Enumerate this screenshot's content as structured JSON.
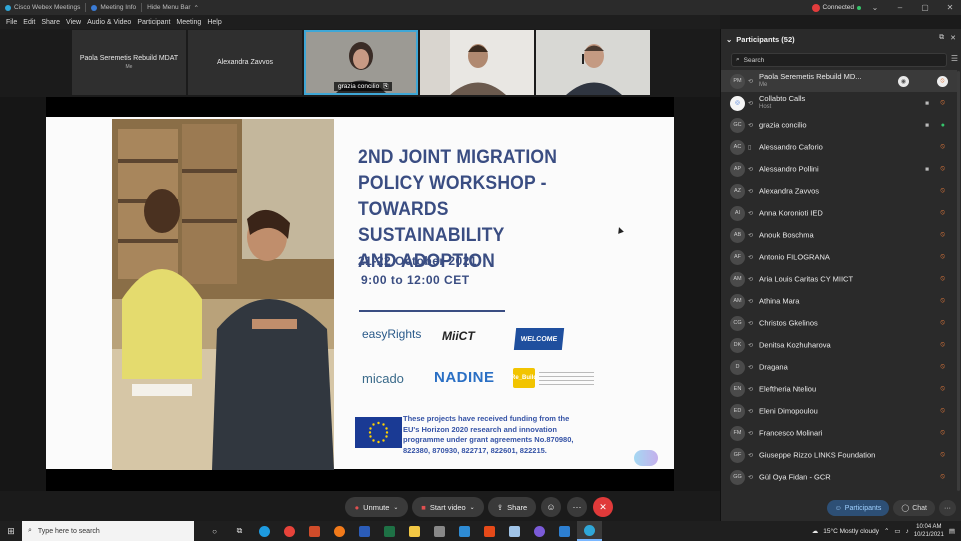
{
  "titlebar": {
    "app_title": "Cisco Webex Meetings",
    "meeting_info": "Meeting Info",
    "hide_menu_bar": "Hide Menu Bar",
    "status": "Connected"
  },
  "menu": [
    "File",
    "Edit",
    "Share",
    "View",
    "Audio & Video",
    "Participant",
    "Meeting",
    "Help"
  ],
  "video_strip": {
    "tiles": [
      {
        "name": "Paola Seremetis Rebuild MDAT",
        "sub": "Me"
      },
      {
        "name": "Alexandra Zavvos"
      },
      {
        "name": "grazia concilio"
      },
      {
        "name": ""
      },
      {
        "name": ""
      }
    ]
  },
  "slide": {
    "title_lines": [
      "2ND JOINT MIGRATION",
      "POLICY WORKSHOP -",
      "TOWARDS SUSTAINABILITY",
      "AND ADOPTION"
    ],
    "date": "21-22 October 2021",
    "time": "9:00 to 12:00 CET",
    "logos": [
      "easyRights",
      "MiiCT",
      "WELCOME",
      "micado",
      "NADINE",
      "Re_Build"
    ],
    "funding_lines": [
      "These projects have received funding from the",
      "EU's Horizon 2020 research and innovation",
      "programme under grant agreements No.870980,",
      "822380, 870930, 822717, 822601, 822215."
    ],
    "accent_color": "#3a4d82"
  },
  "controls": {
    "unmute": "Unmute",
    "start_video": "Start video",
    "share": "Share",
    "more": "···"
  },
  "panel": {
    "title": "Participants (52)",
    "search_placeholder": "Search",
    "participants": [
      {
        "initials": "PM",
        "name": "Paola Seremetis Rebuild MD...",
        "sub": "Me",
        "cam": "",
        "mic": "muted"
      },
      {
        "initials": "",
        "name": "Collabto Calls",
        "sub": "Host",
        "cam": "cam",
        "mic": "muted"
      },
      {
        "initials": "GC",
        "name": "grazia concilio",
        "sub": "",
        "cam": "cam",
        "mic": "on"
      },
      {
        "initials": "AC",
        "name": "Alessandro Caforio",
        "sub": "",
        "cam": "",
        "mic": "muted"
      },
      {
        "initials": "AP",
        "name": "Alessandro Pollini",
        "sub": "",
        "cam": "cam",
        "mic": "muted"
      },
      {
        "initials": "AZ",
        "name": "Alexandra Zavvos",
        "sub": "",
        "cam": "",
        "mic": "muted"
      },
      {
        "initials": "AI",
        "name": "Anna Koronioti IED",
        "sub": "",
        "cam": "",
        "mic": "muted"
      },
      {
        "initials": "AB",
        "name": "Anouk Boschma",
        "sub": "",
        "cam": "",
        "mic": "muted"
      },
      {
        "initials": "AF",
        "name": "Antonio FILOGRANA",
        "sub": "",
        "cam": "",
        "mic": "muted"
      },
      {
        "initials": "AM",
        "name": "Aria Louis Caritas CY MIICT",
        "sub": "",
        "cam": "",
        "mic": "muted"
      },
      {
        "initials": "AM",
        "name": "Athina Mara",
        "sub": "",
        "cam": "",
        "mic": "muted"
      },
      {
        "initials": "CG",
        "name": "Christos Gkelinos",
        "sub": "",
        "cam": "",
        "mic": "muted"
      },
      {
        "initials": "DK",
        "name": "Denitsa Kozhuharova",
        "sub": "",
        "cam": "",
        "mic": "muted"
      },
      {
        "initials": "D",
        "name": "Dragana",
        "sub": "",
        "cam": "",
        "mic": "muted"
      },
      {
        "initials": "EN",
        "name": "Eleftheria Nteliou",
        "sub": "",
        "cam": "",
        "mic": "muted"
      },
      {
        "initials": "ED",
        "name": "Eleni Dimopoulou",
        "sub": "",
        "cam": "",
        "mic": "muted"
      },
      {
        "initials": "FM",
        "name": "Francesco Molinari",
        "sub": "",
        "cam": "",
        "mic": "muted"
      },
      {
        "initials": "GF",
        "name": "Giuseppe Rizzo LINKS Foundation",
        "sub": "",
        "cam": "",
        "mic": "muted"
      },
      {
        "initials": "GG",
        "name": "Gül Oya Fidan - GCR",
        "sub": "",
        "cam": "",
        "mic": "muted"
      }
    ],
    "footer": {
      "participants_tab": "Participants",
      "chat_tab": "Chat"
    }
  },
  "taskbar": {
    "search_placeholder": "Type here to search",
    "weather": "15°C  Mostly cloudy",
    "time": "10:04 AM",
    "date": "10/21/2021"
  }
}
